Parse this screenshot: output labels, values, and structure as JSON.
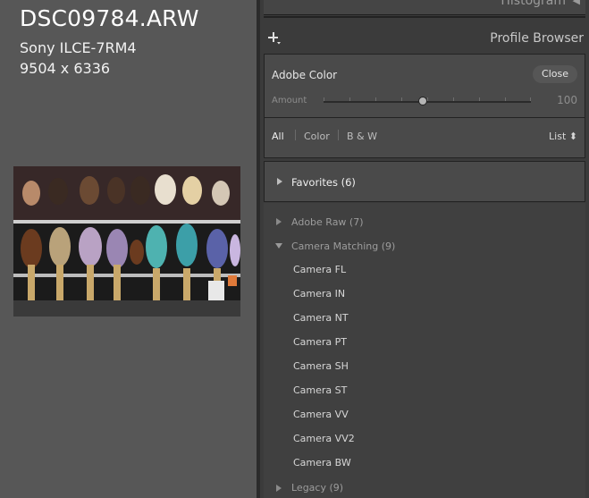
{
  "photo": {
    "filename": "DSC09784.ARW",
    "camera": "Sony ILCE-7RM4",
    "dimensions": "9504 x 6336"
  },
  "panel": {
    "histogram_label": "Histogram",
    "title": "Profile Browser",
    "add_icon": "plus-icon"
  },
  "profile": {
    "name": "Adobe Color",
    "close_label": "Close",
    "amount_label": "Amount",
    "amount_value": "100",
    "amount_fraction": 0.48
  },
  "filters": {
    "all": "All",
    "color": "Color",
    "bw": "B & W",
    "view": "List"
  },
  "favorites": {
    "label": "Favorites (6)"
  },
  "groups": {
    "adobe_raw": "Adobe Raw (7)",
    "camera_matching": "Camera Matching (9)",
    "camera_items": [
      "Camera FL",
      "Camera IN",
      "Camera NT",
      "Camera PT",
      "Camera SH",
      "Camera ST",
      "Camera VV",
      "Camera VV2",
      "Camera BW"
    ],
    "legacy": "Legacy (9)"
  },
  "colors": {
    "panel_bg": "#3b3b3b",
    "preview_bg": "#575757"
  }
}
